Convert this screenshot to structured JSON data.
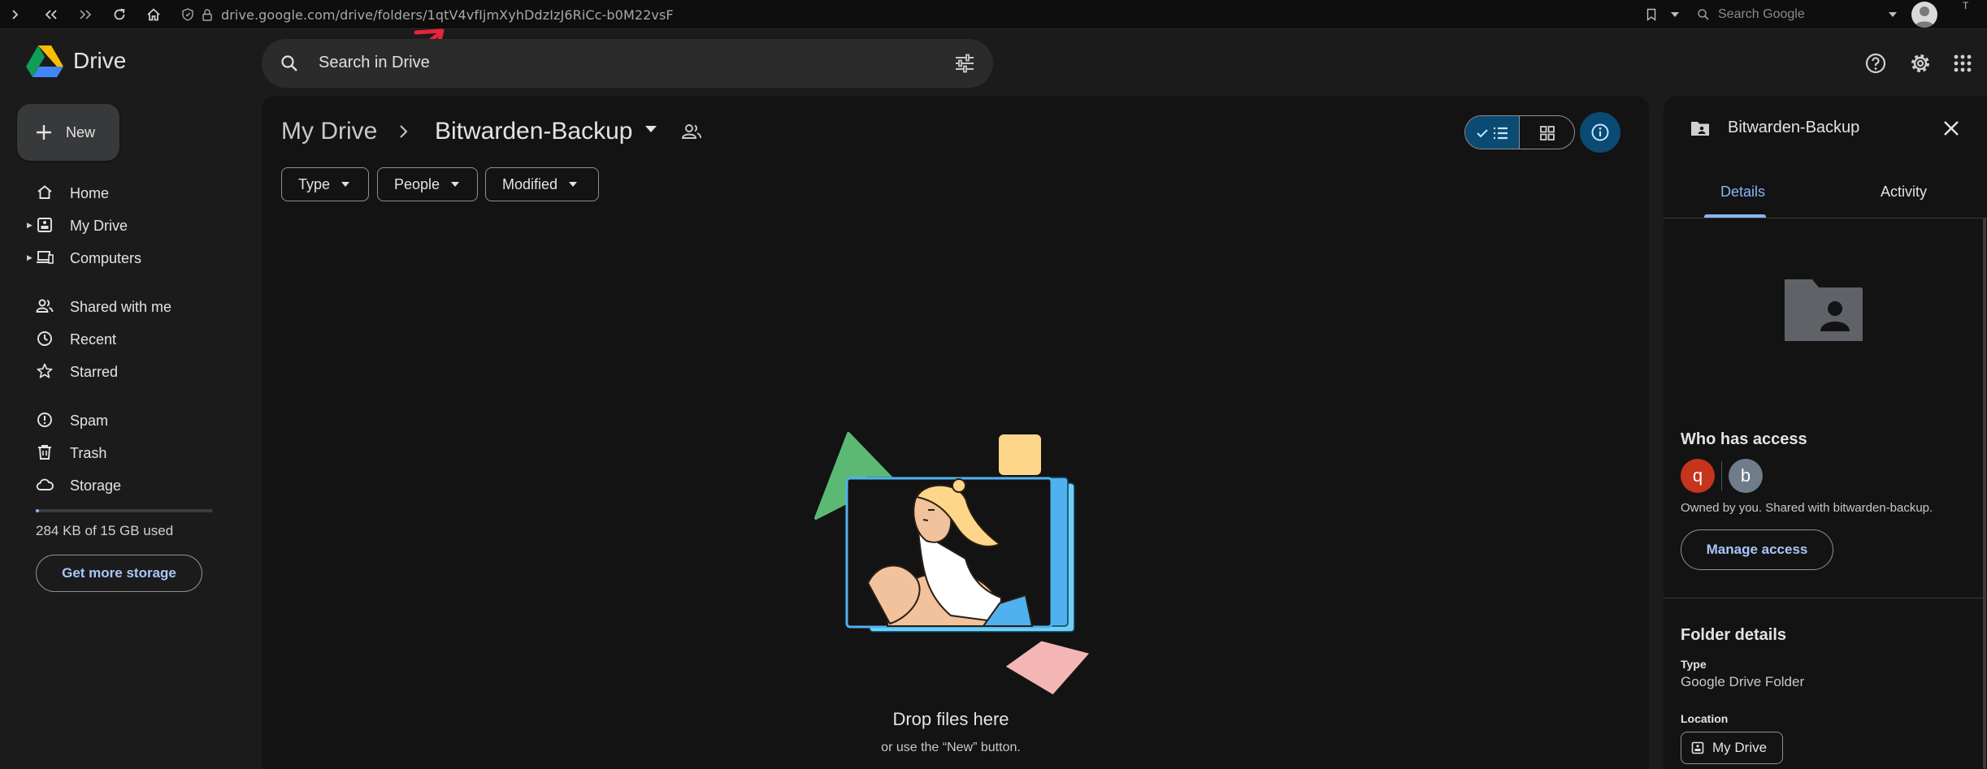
{
  "browser": {
    "url": "drive.google.com/drive/folders/1qtV4vfIjmXyhDdzIzJ6RiCc-b0M22vsF",
    "search_placeholder": "Search Google",
    "corner_text": "T"
  },
  "app": {
    "name": "Drive",
    "search_placeholder": "Search in Drive"
  },
  "sidebar": {
    "new_label": "New",
    "items": [
      {
        "label": "Home",
        "icon": "home-icon"
      },
      {
        "label": "My Drive",
        "icon": "my-drive-icon"
      },
      {
        "label": "Computers",
        "icon": "computers-icon"
      },
      {
        "label": "Shared with me",
        "icon": "shared-icon"
      },
      {
        "label": "Recent",
        "icon": "clock-icon"
      },
      {
        "label": "Starred",
        "icon": "star-icon"
      },
      {
        "label": "Spam",
        "icon": "spam-icon"
      },
      {
        "label": "Trash",
        "icon": "trash-icon"
      },
      {
        "label": "Storage",
        "icon": "cloud-icon"
      }
    ],
    "storage_text": "284 KB of 15 GB used",
    "storage_used_fraction": 0.02,
    "get_storage_label": "Get more storage"
  },
  "main": {
    "breadcrumb_root": "My Drive",
    "folder_name": "Bitwarden-Backup",
    "filters": [
      "Type",
      "People",
      "Modified"
    ],
    "drop_title": "Drop files here",
    "drop_subtitle": "or use the “New” button."
  },
  "details": {
    "title": "Bitwarden-Backup",
    "tabs": [
      "Details",
      "Activity"
    ],
    "active_tab": "Details",
    "who_has_access": "Who has access",
    "avatars": [
      {
        "letter": "q",
        "color": "#c5341b"
      },
      {
        "letter": "b",
        "color": "#6f7c89"
      }
    ],
    "owned_text": "Owned by you. Shared with bitwarden-backup.",
    "manage_access_label": "Manage access",
    "folder_details_heading": "Folder details",
    "type_label": "Type",
    "type_value": "Google Drive Folder",
    "location_label": "Location",
    "location_value": "My Drive"
  },
  "colors": {
    "accent": "#8ab4f8",
    "link": "#a8c7fa",
    "selected_bg": "#0b4a72",
    "annotation_arrow": "#e8243a"
  }
}
